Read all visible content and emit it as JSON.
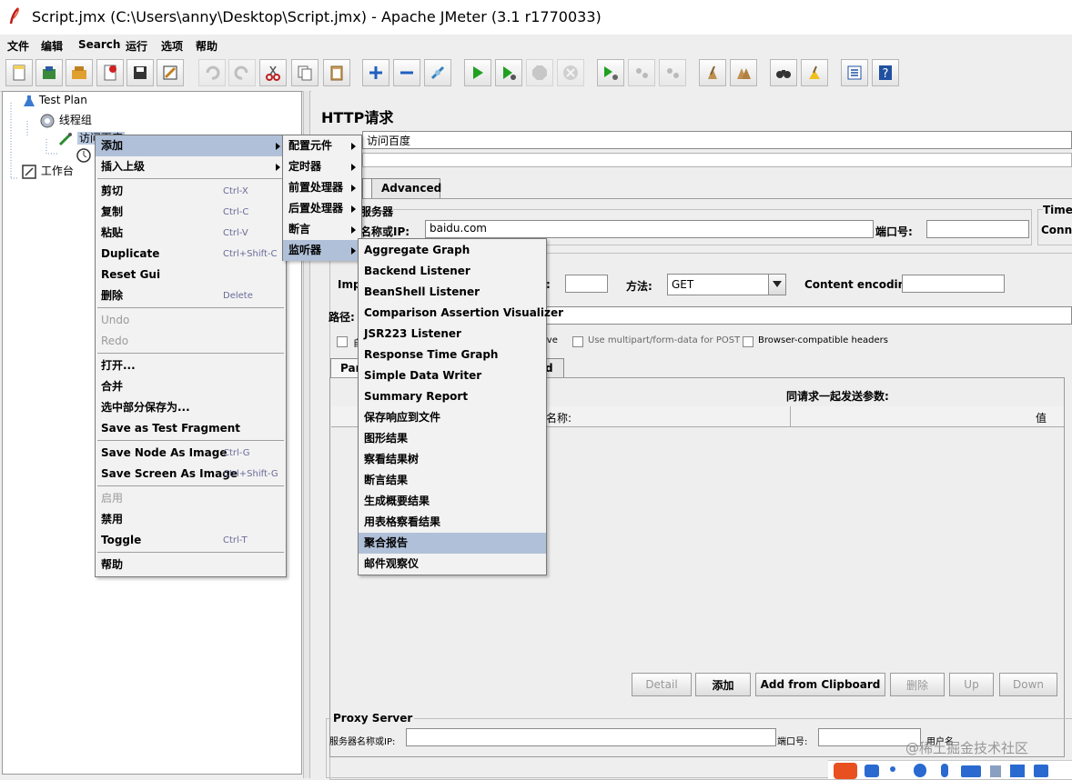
{
  "window": {
    "title": "Script.jmx (C:\\Users\\anny\\Desktop\\Script.jmx) - Apache JMeter (3.1 r1770033)"
  },
  "menubar": [
    "文件",
    "编辑",
    "Search",
    "运行",
    "选项",
    "帮助"
  ],
  "tree": {
    "test_plan": "Test Plan",
    "thread_group": "线程组",
    "sampler": "访问百度",
    "workbench": "工作台"
  },
  "panel": {
    "title": "HTTP请求",
    "name_value": "访问百度",
    "tab_advanced": "Advanced",
    "server_section": "服务器",
    "server_label": "名称或IP:",
    "server_value": "baidu.com",
    "port_label": "端口号:",
    "timeouts_label": "Timeo",
    "connect_label": "Conne",
    "impl_label": "Imp",
    "method_label": "方法:",
    "method_value": "GET",
    "content_encoding_label": "Content encoding:",
    "path_label": "路径:",
    "opt_redirect": "自",
    "opt_keepalive": "ive",
    "opt_multipart": "Use multipart/form-data for POST",
    "opt_browser_headers": "Browser-compatible headers",
    "tab_params": "Par",
    "tab_body": "d",
    "params_title": "同请求一起发送参数:",
    "col_name": "名称:",
    "col_value": "值",
    "btn_detail": "Detail",
    "btn_add": "添加",
    "btn_add_clipboard": "Add from Clipboard",
    "btn_delete": "删除",
    "btn_up": "Up",
    "btn_down": "Down",
    "proxy_title": "Proxy Server",
    "proxy_server_label": "服务器名称或IP:",
    "proxy_port_label": "端口号:",
    "proxy_user_label": "用户名"
  },
  "context_menu": {
    "items": [
      {
        "label": "添加",
        "shortcut": "",
        "submenu": true,
        "highlight": true,
        "disabled": false
      },
      {
        "label": "插入上级",
        "shortcut": "",
        "submenu": true,
        "highlight": false,
        "disabled": false
      },
      {
        "label": "剪切",
        "shortcut": "Ctrl-X",
        "disabled": false
      },
      {
        "label": "复制",
        "shortcut": "Ctrl-C",
        "disabled": false
      },
      {
        "label": "粘贴",
        "shortcut": "Ctrl-V",
        "disabled": false
      },
      {
        "label": "Duplicate",
        "shortcut": "Ctrl+Shift-C",
        "disabled": false
      },
      {
        "label": "Reset Gui",
        "shortcut": "",
        "disabled": false
      },
      {
        "label": "删除",
        "shortcut": "Delete",
        "disabled": false
      },
      {
        "label": "Undo",
        "shortcut": "",
        "disabled": true
      },
      {
        "label": "Redo",
        "shortcut": "",
        "disabled": true
      },
      {
        "label": "打开...",
        "shortcut": "",
        "disabled": false
      },
      {
        "label": "合并",
        "shortcut": "",
        "disabled": false
      },
      {
        "label": "选中部分保存为...",
        "shortcut": "",
        "disabled": false
      },
      {
        "label": "Save as Test Fragment",
        "shortcut": "",
        "disabled": false
      },
      {
        "label": "Save Node As Image",
        "shortcut": "Ctrl-G",
        "disabled": false
      },
      {
        "label": "Save Screen As Image",
        "shortcut": "Ctrl+Shift-G",
        "disabled": false
      },
      {
        "label": "启用",
        "shortcut": "",
        "disabled": true
      },
      {
        "label": "禁用",
        "shortcut": "",
        "disabled": false
      },
      {
        "label": "Toggle",
        "shortcut": "Ctrl-T",
        "disabled": false
      },
      {
        "label": "帮助",
        "shortcut": "",
        "disabled": false
      }
    ]
  },
  "add_submenu": {
    "items": [
      "配置元件",
      "定时器",
      "前置处理器",
      "后置处理器",
      "断言",
      "监听器"
    ]
  },
  "listener_submenu": {
    "items": [
      "Aggregate Graph",
      "Backend Listener",
      "BeanShell Listener",
      "Comparison Assertion Visualizer",
      "JSR223 Listener",
      "Response Time Graph",
      "Simple Data Writer",
      "Summary Report",
      "保存响应到文件",
      "图形结果",
      "察看结果树",
      "断言结果",
      "生成概要结果",
      "用表格察看结果",
      "聚合报告",
      "邮件观察仪"
    ],
    "highlighted_index": 14
  },
  "watermark": {
    "text": "@稀土掘金技术社区"
  },
  "colors": {
    "menu_highlight": "#b0c0d8",
    "disabled_text": "#9a9a9a"
  }
}
